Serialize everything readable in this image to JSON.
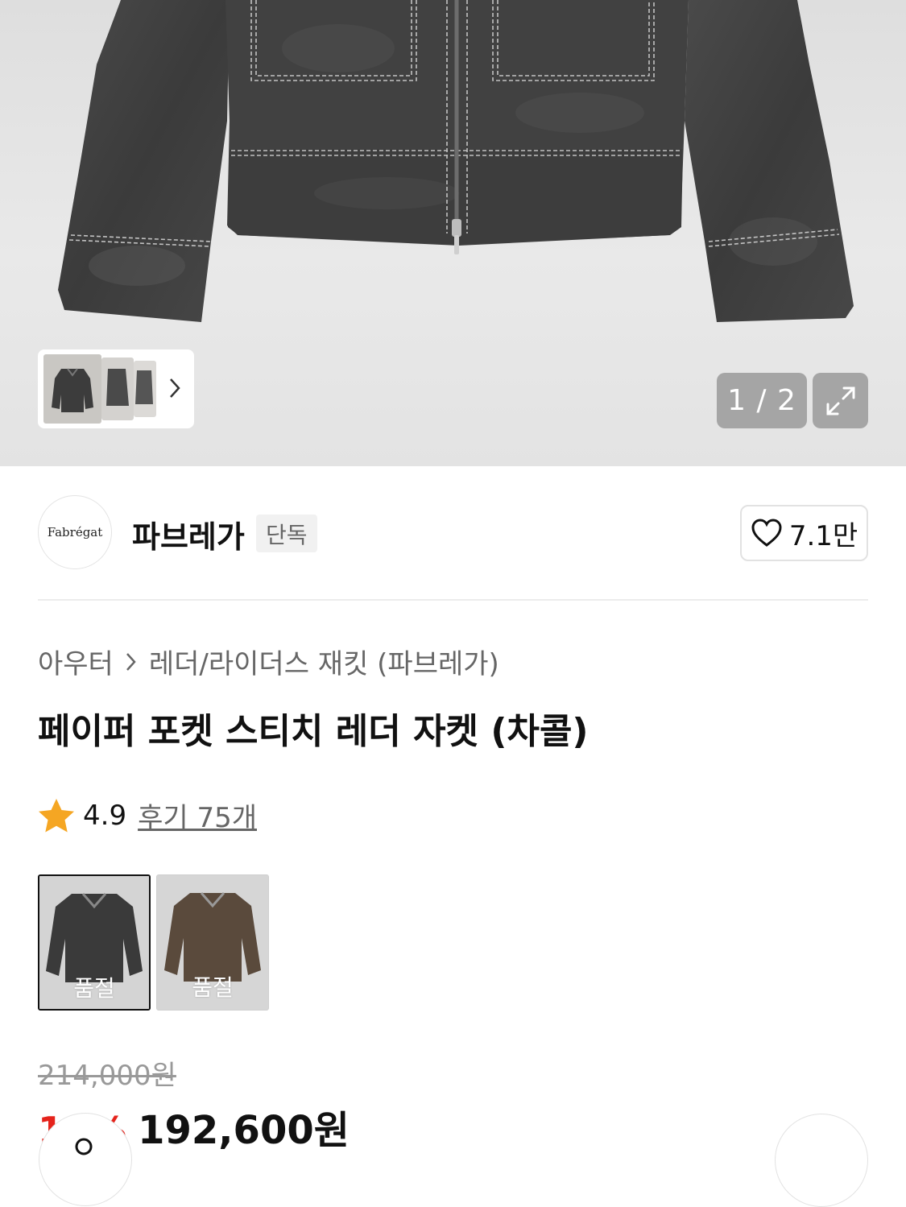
{
  "gallery": {
    "counter": "1 / 2",
    "image_subject": "charcoal leather jacket"
  },
  "brand": {
    "logo_text": "Fabrégat",
    "name": "파브레가",
    "badge": "단독",
    "likes": "7.1만"
  },
  "product": {
    "breadcrumb": [
      "아우터",
      "레더/라이더스 재킷 (파브레가)"
    ],
    "title": "페이퍼 포켓 스티치 레더 자켓 (차콜)",
    "rating": "4.9",
    "reviews": "후기 75개",
    "swatches": [
      {
        "status": "품절",
        "color": "#3a3a3a"
      },
      {
        "status": "품절",
        "color": "#5a4a3c"
      }
    ],
    "original_price": "214,000원",
    "discount": "10%",
    "price": "192,600원"
  },
  "colors": {
    "discount_red": "#e5231b",
    "star_orange": "#f5a623"
  }
}
